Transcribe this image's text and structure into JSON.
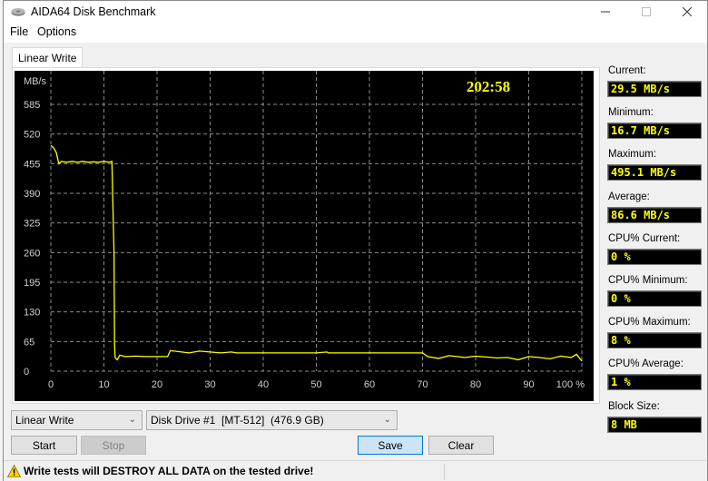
{
  "window": {
    "title": "AIDA64 Disk Benchmark",
    "icon": "disk-drive-icon",
    "controls": [
      "minimize",
      "maximize",
      "close"
    ]
  },
  "menu": {
    "file": "File",
    "options": "Options"
  },
  "tabs": [
    {
      "label": "Linear Write",
      "active": true
    }
  ],
  "timer": "202:58",
  "stats": [
    {
      "label": "Current:",
      "value": "29.5 MB/s"
    },
    {
      "label": "Minimum:",
      "value": "16.7 MB/s"
    },
    {
      "label": "Maximum:",
      "value": "495.1 MB/s"
    },
    {
      "label": "Average:",
      "value": "86.6 MB/s"
    },
    {
      "label": "CPU% Current:",
      "value": "0 %"
    },
    {
      "label": "CPU% Minimum:",
      "value": "0 %"
    },
    {
      "label": "CPU% Maximum:",
      "value": "8 %"
    },
    {
      "label": "CPU% Average:",
      "value": "1 %"
    },
    {
      "label": "Block Size:",
      "value": "8 MB"
    }
  ],
  "controls": {
    "test_select": "Linear Write",
    "drive_select": "Disk Drive #1  [MT-512]  (476.9 GB)",
    "start": "Start",
    "stop": "Stop",
    "save": "Save",
    "clear": "Clear"
  },
  "status": {
    "warning": "Write tests will DESTROY ALL DATA on the tested drive!"
  },
  "colors": {
    "line": "#ffff00",
    "background": "#000000",
    "grid": "#8c8c8c",
    "axis_text": "#d0d0d0"
  },
  "chart_data": {
    "type": "line",
    "title": "Linear Write",
    "ylabel": "MB/s",
    "xlabel": "%",
    "ylim": [
      0,
      585
    ],
    "xlim": [
      0,
      100
    ],
    "yticks": [
      0,
      65,
      130,
      195,
      260,
      325,
      390,
      455,
      520,
      585
    ],
    "xticks": [
      0,
      10,
      20,
      30,
      40,
      50,
      60,
      70,
      80,
      90,
      100
    ],
    "xtick_labels": [
      "0",
      "10",
      "20",
      "30",
      "40",
      "50",
      "60",
      "70",
      "80",
      "90",
      "100 %"
    ],
    "grid": true,
    "series": [
      {
        "name": "Linear Write",
        "x": [
          0,
          0.5,
          1,
          1.5,
          2,
          3,
          4,
          5,
          6,
          7,
          8,
          9,
          10,
          11,
          11.5,
          11.9,
          12.0,
          12.1,
          12.5,
          13,
          14,
          16,
          18,
          20,
          22,
          22.5,
          24,
          26,
          28,
          30,
          32,
          34,
          35,
          40,
          50,
          52,
          52.3,
          60,
          70,
          71,
          73,
          75,
          78,
          80,
          82,
          84,
          86,
          88,
          90,
          92,
          94,
          96,
          98,
          99,
          100
        ],
        "y": [
          495,
          490,
          480,
          455,
          460,
          458,
          460,
          458,
          460,
          458,
          459,
          458,
          460,
          458,
          460,
          260,
          60,
          30,
          25,
          35,
          32,
          33,
          32,
          32,
          32,
          45,
          43,
          40,
          44,
          42,
          40,
          42,
          40,
          40,
          40,
          42,
          40,
          40,
          40,
          32,
          28,
          34,
          30,
          33,
          31,
          29,
          30,
          25,
          32,
          30,
          27,
          33,
          30,
          37,
          22
        ]
      }
    ]
  }
}
